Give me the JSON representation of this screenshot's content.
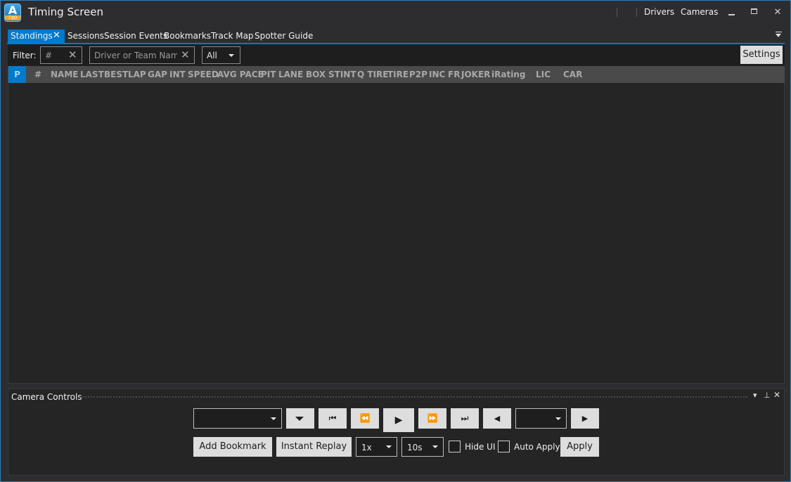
{
  "app": {
    "logo_letter": "A",
    "logo_sub": "TVO",
    "title": "Timing Screen",
    "links": {
      "drivers": "Drivers",
      "cameras": "Cameras"
    }
  },
  "window_controls": {
    "minimize": "▁",
    "maximize": "□",
    "close": "✕"
  },
  "tabs": [
    {
      "label": "Standings",
      "active": true
    },
    {
      "label": "Sessions"
    },
    {
      "label": "Session Events"
    },
    {
      "label": "Bookmarks"
    },
    {
      "label": "Track Map"
    },
    {
      "label": "Spotter Guide"
    }
  ],
  "tab_close": "✕",
  "filter": {
    "label": "Filter:",
    "number_placeholder": "#",
    "name_placeholder": "Driver or Team Name",
    "clear": "✕",
    "class_selected": "All",
    "settings_label": "Settings"
  },
  "columns": [
    "P",
    "#",
    "NAME",
    "LAST",
    "BEST",
    "LAP",
    "GAP",
    "INT",
    "SPEED",
    "AVG PACE",
    "PIT",
    "LANE",
    "BOX",
    "STINT",
    "Q TIRE",
    "TIRE",
    "P2P",
    "INC",
    "FR",
    "JOKER",
    "iRating",
    "LIC",
    "CAR"
  ],
  "camera_controls": {
    "title": "Camera Controls",
    "panel_buttons": {
      "menu": "▾",
      "pin": "⊥",
      "close": "✕"
    },
    "driver_select": "",
    "camera_select": "",
    "add_bookmark": "Add Bookmark",
    "instant_replay": "Instant Replay",
    "speed_selected": "1x",
    "jump_selected": "10s",
    "hide_ui": "Hide UI",
    "auto_apply": "Auto Apply",
    "apply": "Apply",
    "icons": {
      "dropdown": "dropdown-arrow-icon",
      "skip_start": "skip-to-start-icon",
      "rewind": "rewind-icon",
      "play": "play-icon",
      "fast_forward": "fast-forward-icon",
      "skip_end": "skip-to-end-icon",
      "prev": "previous-camera-icon",
      "next": "next-camera-icon"
    }
  },
  "colors": {
    "accent": "#007acc",
    "background": "#2d2d30",
    "panel": "#252526",
    "button": "#dddddd"
  }
}
